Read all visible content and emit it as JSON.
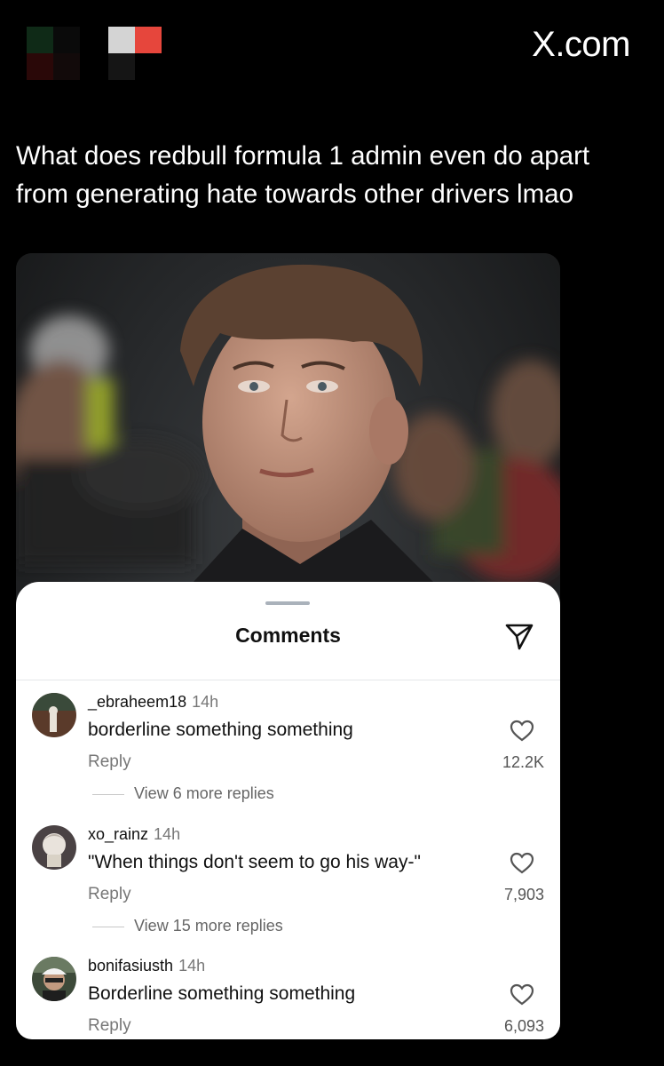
{
  "header": {
    "site": "X.com"
  },
  "tweet": {
    "text": "What does redbull formula 1 admin even do apart from generating hate towards other drivers lmao"
  },
  "comments_sheet": {
    "title": "Comments",
    "comments": [
      {
        "username": "_ebraheem18",
        "time": "14h",
        "text": "borderline something something",
        "reply_label": "Reply",
        "likes": "12.2K",
        "view_more": "View 6 more replies"
      },
      {
        "username": "xo_rainz",
        "time": "14h",
        "text": "\"When things don't seem to go his way-\"",
        "reply_label": "Reply",
        "likes": "7,903",
        "view_more": "View 15 more replies"
      },
      {
        "username": "bonifasiusth",
        "time": "14h",
        "text": "Borderline something something",
        "reply_label": "Reply",
        "likes": "6,093"
      }
    ]
  },
  "icons": {
    "send": "paper-plane-icon",
    "like": "heart-icon"
  },
  "colors": {
    "background": "#000000",
    "sheet": "#ffffff",
    "muted_text": "#777777"
  }
}
